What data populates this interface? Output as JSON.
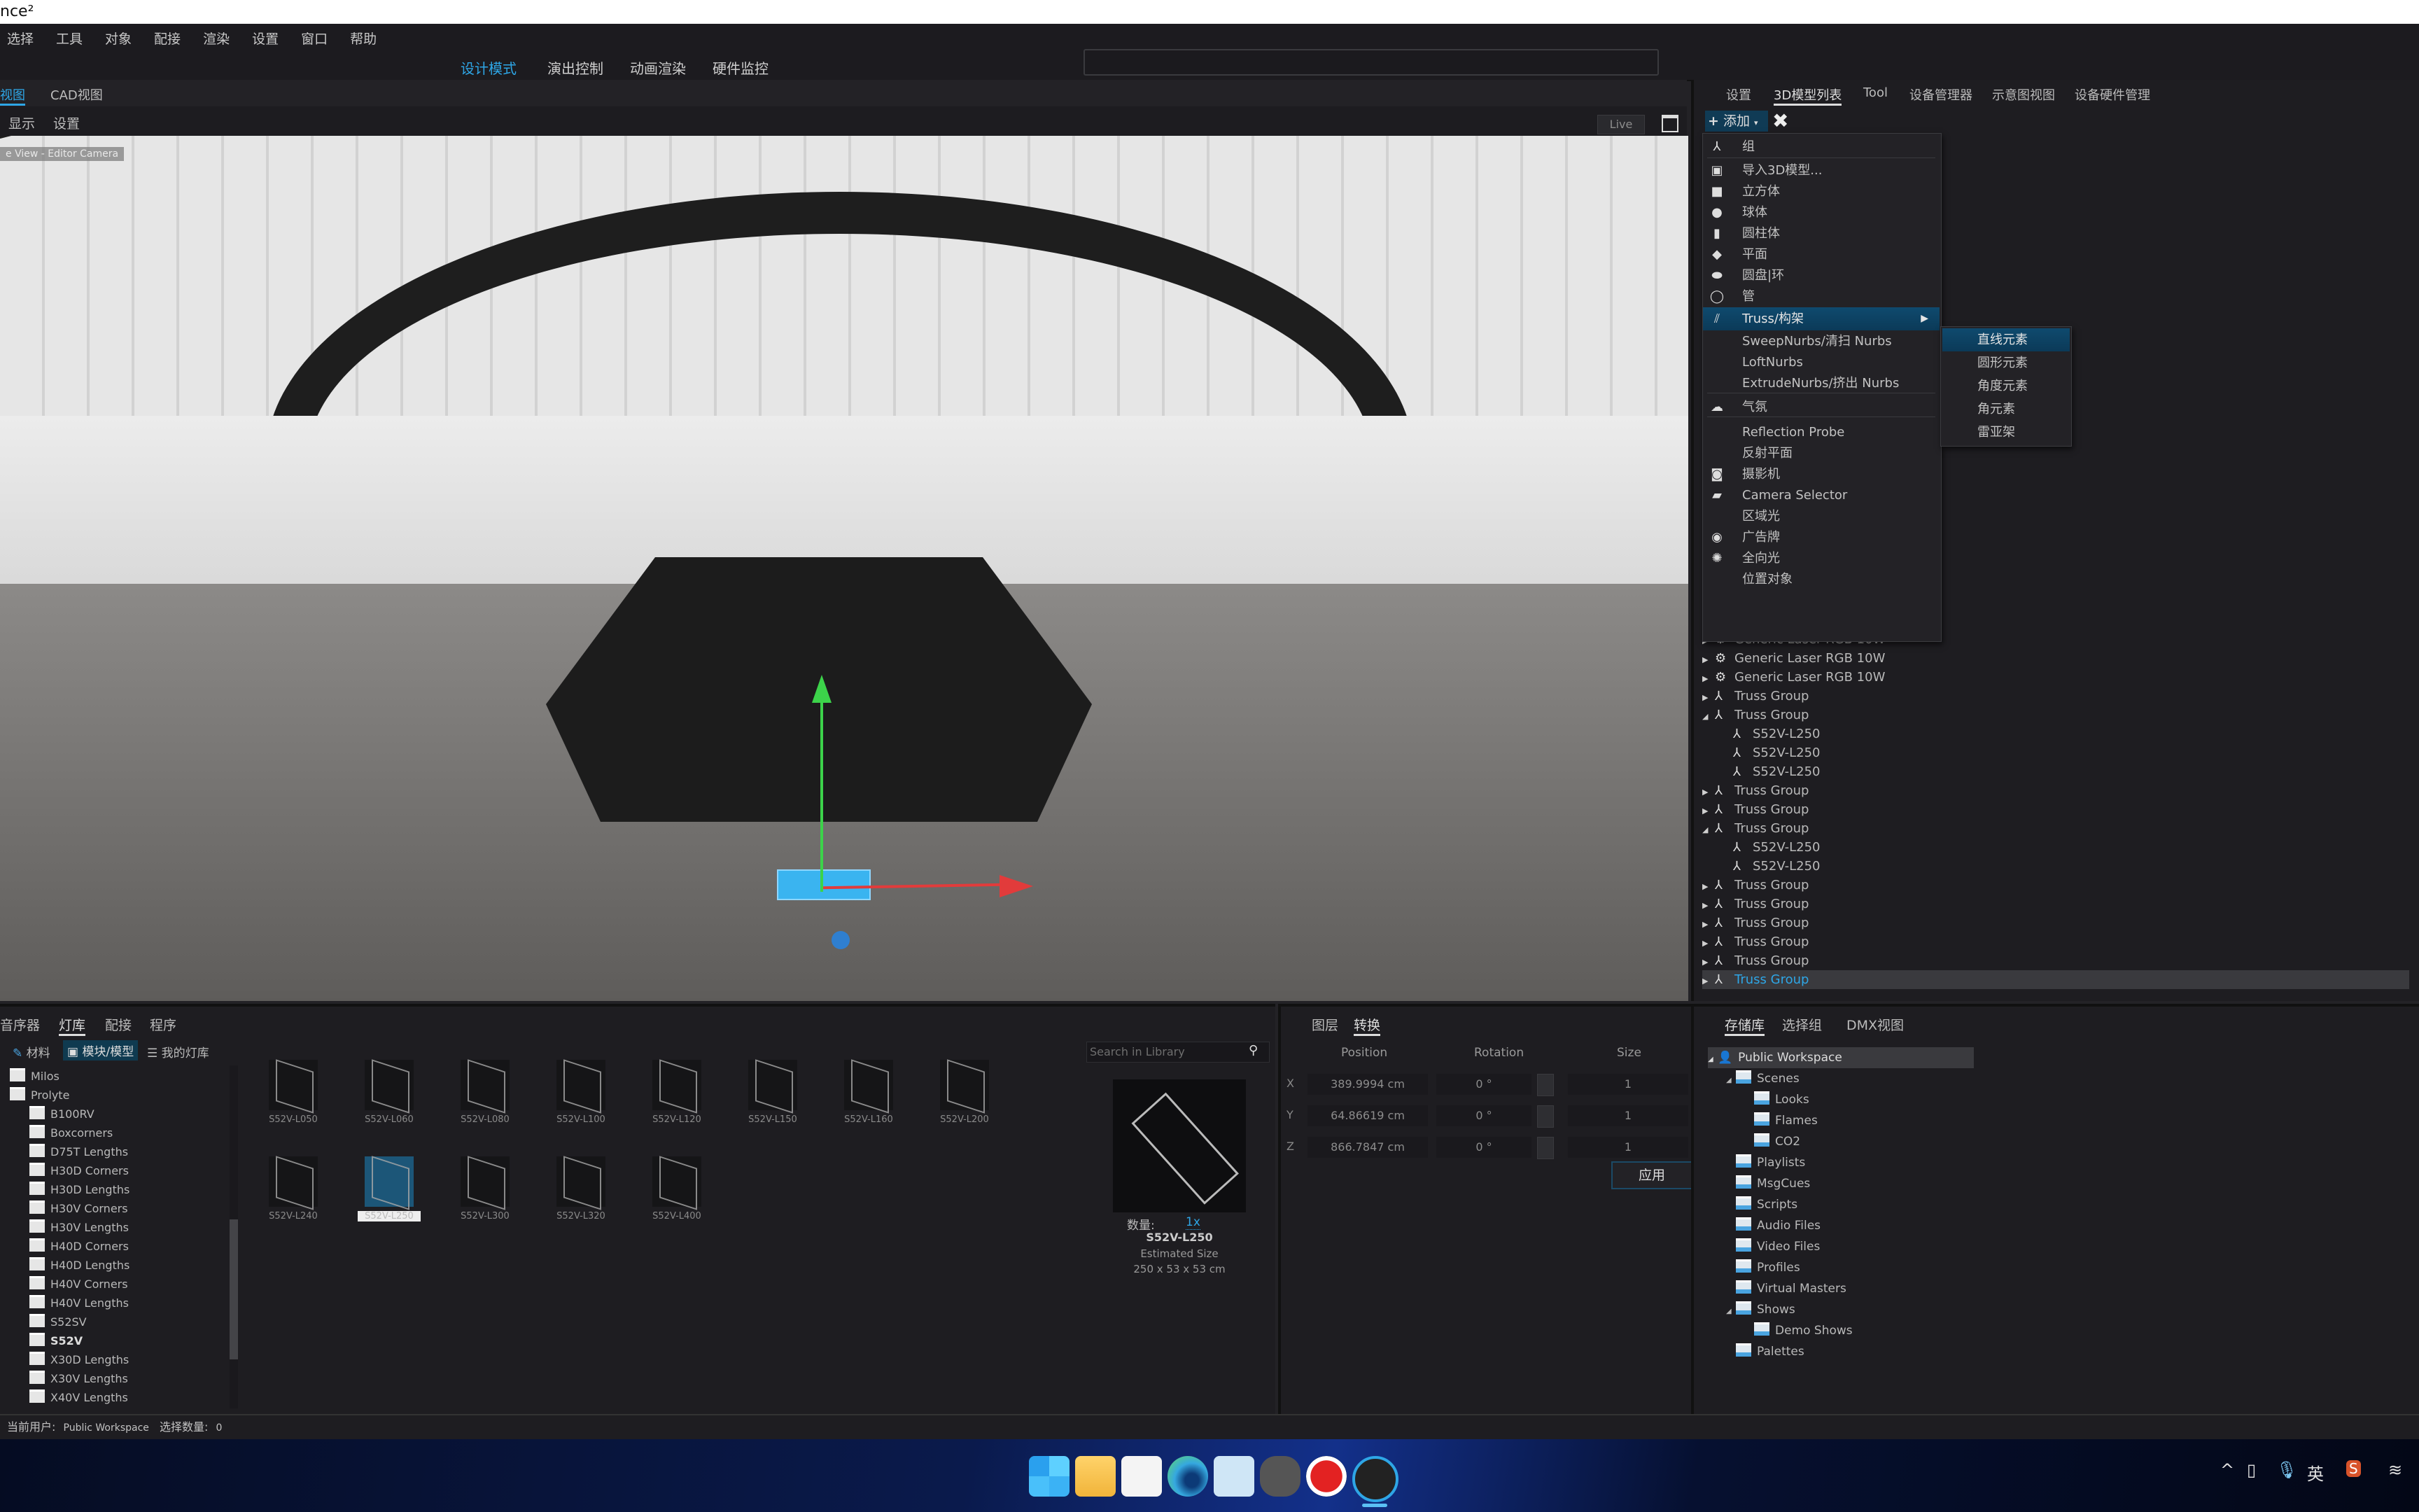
{
  "app": {
    "title_fragment": "nce²"
  },
  "menubar": [
    "选择",
    "工具",
    "对象",
    "配接",
    "渲染",
    "设置",
    "窗口",
    "帮助"
  ],
  "modes": [
    {
      "label": "设计模式",
      "active": true
    },
    {
      "label": "演出控制",
      "active": false
    },
    {
      "label": "动画渲染",
      "active": false
    },
    {
      "label": "硬件监控",
      "active": false
    }
  ],
  "view_tabs": [
    {
      "label": "视图",
      "active": true
    },
    {
      "label": "CAD视图",
      "active": false
    }
  ],
  "view_sub": [
    "显示",
    "设置"
  ],
  "viewport": {
    "camera_label": "e View - Editor Camera",
    "live_label": "Live"
  },
  "right_tabs": [
    {
      "label": "设置",
      "active": false
    },
    {
      "label": "3D模型列表",
      "active": true
    },
    {
      "label": "Tool",
      "active": false
    },
    {
      "label": "设备管理器",
      "active": false
    },
    {
      "label": "示意图视图",
      "active": false
    },
    {
      "label": "设备硬件管理",
      "active": false
    }
  ],
  "toolbar": {
    "add_label": "添加",
    "add_icon": "plus-icon",
    "delete_icon": "close-icon"
  },
  "add_menu": {
    "items": [
      {
        "label": "组",
        "icon": "group-icon",
        "glyph": "⅄"
      },
      {
        "label": "导入3D模型...",
        "icon": "import-model-icon",
        "glyph": "▣"
      },
      {
        "label": "立方体",
        "icon": "cube-icon",
        "glyph": "■"
      },
      {
        "label": "球体",
        "icon": "sphere-icon",
        "glyph": "●"
      },
      {
        "label": "圆柱体",
        "icon": "cylinder-icon",
        "glyph": "▮"
      },
      {
        "label": "平面",
        "icon": "plane-icon",
        "glyph": "◆"
      },
      {
        "label": "圆盘|环",
        "icon": "disc-icon",
        "glyph": "⬬"
      },
      {
        "label": "管",
        "icon": "tube-icon",
        "glyph": "◯"
      },
      {
        "label": "Truss/构架",
        "icon": "truss-icon",
        "glyph": "⫽",
        "highlighted": true,
        "has_submenu": true
      },
      {
        "label": "SweepNurbs/清扫 Nurbs",
        "icon": "",
        "glyph": ""
      },
      {
        "label": "LoftNurbs",
        "icon": "",
        "glyph": ""
      },
      {
        "label": "ExtrudeNurbs/挤出 Nurbs",
        "icon": "",
        "glyph": ""
      },
      {
        "label": "气氛",
        "icon": "atmosphere-icon",
        "glyph": "☁"
      },
      {
        "label": "Reflection Probe",
        "icon": "",
        "glyph": ""
      },
      {
        "label": "反射平面",
        "icon": "",
        "glyph": ""
      },
      {
        "label": "摄影机",
        "icon": "camera-icon",
        "glyph": "◙"
      },
      {
        "label": "Camera Selector",
        "icon": "clapper-icon",
        "glyph": "▰"
      },
      {
        "label": "区域光",
        "icon": "",
        "glyph": ""
      },
      {
        "label": "广告牌",
        "icon": "billboard-icon",
        "glyph": "◉"
      },
      {
        "label": "全向光",
        "icon": "bulb-icon",
        "glyph": "✺"
      },
      {
        "label": "位置对象",
        "icon": "",
        "glyph": ""
      }
    ],
    "submenu": [
      {
        "label": "直线元素",
        "highlighted": true
      },
      {
        "label": "圆形元素"
      },
      {
        "label": "角度元素"
      },
      {
        "label": "角元素"
      },
      {
        "label": "雷亚架"
      }
    ]
  },
  "scene_tree": [
    {
      "label": "Generic Laser RGB 10W",
      "type": "laser",
      "level": 0,
      "expanded": false
    },
    {
      "label": "Generic Laser RGB 10W",
      "type": "laser",
      "level": 0,
      "expanded": false
    },
    {
      "label": "Generic Laser RGB 10W",
      "type": "laser",
      "level": 0,
      "expanded": false
    },
    {
      "label": "Truss Group",
      "type": "group",
      "level": 0,
      "expanded": false
    },
    {
      "label": "Truss Group",
      "type": "group",
      "level": 0,
      "expanded": true
    },
    {
      "label": "S52V-L250",
      "type": "item",
      "level": 1
    },
    {
      "label": "S52V-L250",
      "type": "item",
      "level": 1
    },
    {
      "label": "S52V-L250",
      "type": "item",
      "level": 1
    },
    {
      "label": "Truss Group",
      "type": "group",
      "level": 0,
      "expanded": false
    },
    {
      "label": "Truss Group",
      "type": "group",
      "level": 0,
      "expanded": false
    },
    {
      "label": "Truss Group",
      "type": "group",
      "level": 0,
      "expanded": true
    },
    {
      "label": "S52V-L250",
      "type": "item",
      "level": 1
    },
    {
      "label": "S52V-L250",
      "type": "item",
      "level": 1
    },
    {
      "label": "Truss Group",
      "type": "group",
      "level": 0,
      "expanded": false
    },
    {
      "label": "Truss Group",
      "type": "group",
      "level": 0,
      "expanded": false
    },
    {
      "label": "Truss Group",
      "type": "group",
      "level": 0,
      "expanded": false
    },
    {
      "label": "Truss Group",
      "type": "group",
      "level": 0,
      "expanded": false
    },
    {
      "label": "Truss Group",
      "type": "group",
      "level": 0,
      "expanded": false
    },
    {
      "label": "Truss Group",
      "type": "group",
      "level": 0,
      "expanded": false,
      "selected": true
    }
  ],
  "library": {
    "tabs": [
      {
        "label": "音序器",
        "active": false
      },
      {
        "label": "灯库",
        "active": true
      },
      {
        "label": "配接",
        "active": false
      },
      {
        "label": "程序",
        "active": false
      }
    ],
    "subtabs": [
      {
        "label": "材料",
        "icon": "brush-icon",
        "active": false
      },
      {
        "label": "模块/模型",
        "icon": "module-icon",
        "active": true
      },
      {
        "label": "我的灯库",
        "icon": "database-icon",
        "active": false
      }
    ],
    "folders": [
      {
        "label": "Milos",
        "level": 0
      },
      {
        "label": "Prolyte",
        "level": 0
      },
      {
        "label": "B100RV",
        "level": 1
      },
      {
        "label": "Boxcorners",
        "level": 1
      },
      {
        "label": "D75T Lengths",
        "level": 1
      },
      {
        "label": "H30D Corners",
        "level": 1
      },
      {
        "label": "H30D Lengths",
        "level": 1
      },
      {
        "label": "H30V Corners",
        "level": 1
      },
      {
        "label": "H30V Lengths",
        "level": 1
      },
      {
        "label": "H40D Corners",
        "level": 1
      },
      {
        "label": "H40D Lengths",
        "level": 1
      },
      {
        "label": "H40V Corners",
        "level": 1
      },
      {
        "label": "H40V Lengths",
        "level": 1
      },
      {
        "label": "S52SV",
        "level": 1
      },
      {
        "label": "S52V",
        "level": 1,
        "bold": true
      },
      {
        "label": "X30D Lengths",
        "level": 1
      },
      {
        "label": "X30V Lengths",
        "level": 1
      },
      {
        "label": "X40V Lengths",
        "level": 1
      }
    ],
    "items": [
      "S52V-L050",
      "S52V-L060",
      "S52V-L080",
      "S52V-L100",
      "S52V-L120",
      "S52V-L150",
      "S52V-L160",
      "S52V-L200",
      "S52V-L240",
      "S52V-L250",
      "S52V-L300",
      "S52V-L320",
      "S52V-L400"
    ],
    "selected_item": "S52V-L250",
    "search_placeholder": "Search in Library",
    "preview": {
      "qty_label": "数量:",
      "qty_value": "1x",
      "name": "S52V-L250",
      "size_label": "Estimated Size",
      "size_value": "250 x 53 x 53 cm"
    }
  },
  "transform": {
    "tabs": [
      {
        "label": "图层",
        "active": false
      },
      {
        "label": "转换",
        "active": true
      }
    ],
    "headers": {
      "position": "Position",
      "rotation": "Rotation",
      "size": "Size"
    },
    "rows": [
      {
        "axis": "X",
        "position": "389.9994 cm",
        "rotation": "0 °",
        "size": "1"
      },
      {
        "axis": "Y",
        "position": "64.86619 cm",
        "rotation": "0 °",
        "size": "1"
      },
      {
        "axis": "Z",
        "position": "866.7847 cm",
        "rotation": "0 °",
        "size": "1"
      }
    ],
    "apply_label": "应用"
  },
  "storage": {
    "tabs": [
      {
        "label": "存储库",
        "active": true
      },
      {
        "label": "选择组",
        "active": false
      },
      {
        "label": "DMX视图",
        "active": false
      }
    ],
    "tree": [
      {
        "label": "Public Workspace",
        "level": 0,
        "icon": "user-icon",
        "expanded": true,
        "selected": true
      },
      {
        "label": "Scenes",
        "level": 1,
        "expanded": true
      },
      {
        "label": "Looks",
        "level": 2
      },
      {
        "label": "Flames",
        "level": 2
      },
      {
        "label": "CO2",
        "level": 2
      },
      {
        "label": "Playlists",
        "level": 1
      },
      {
        "label": "MsgCues",
        "level": 1
      },
      {
        "label": "Scripts",
        "level": 1
      },
      {
        "label": "Audio Files",
        "level": 1
      },
      {
        "label": "Video Files",
        "level": 1
      },
      {
        "label": "Profiles",
        "level": 1
      },
      {
        "label": "Virtual Masters",
        "level": 1
      },
      {
        "label": "Shows",
        "level": 1,
        "expanded": true
      },
      {
        "label": "Demo Shows",
        "level": 2
      },
      {
        "label": "Palettes",
        "level": 1
      }
    ]
  },
  "status": {
    "user_label": "当前用户:",
    "user_value": "Public Workspace",
    "selection_label": "选择数量:",
    "selection_value": "0"
  },
  "taskbar": {
    "apps": [
      "windows-start",
      "file-explorer",
      "microsoft-store",
      "edge",
      "resource-monitor",
      "skull-app",
      "record-app",
      "grandma-app"
    ],
    "tray": {
      "ime": "英"
    }
  },
  "colors": {
    "accent": "#2ea6e6",
    "menu_highlight": "#0f4a6e",
    "panel": "#1e1d21",
    "background": "#232226"
  }
}
